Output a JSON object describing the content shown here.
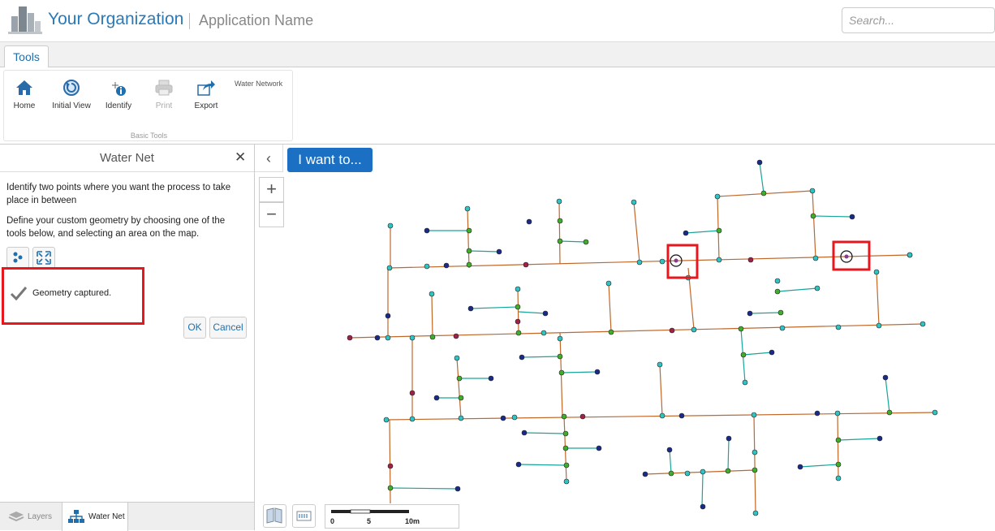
{
  "header": {
    "org_name": "Your Organization",
    "app_name": "Application Name",
    "search_placeholder": "Search..."
  },
  "ribbon": {
    "tabs": [
      "Tools"
    ],
    "tools": [
      {
        "label": "Home",
        "icon": "home-icon",
        "enabled": true
      },
      {
        "label": "Initial View",
        "icon": "initial-view-icon",
        "enabled": true
      },
      {
        "label": "Identify",
        "icon": "identify-icon",
        "enabled": true
      },
      {
        "label": "Print",
        "icon": "printer-icon",
        "enabled": false
      },
      {
        "label": "Export",
        "icon": "export-icon",
        "enabled": true
      }
    ],
    "group_label": "Basic Tools",
    "extra_label": "Water Network"
  },
  "panel": {
    "title": "Water Net",
    "instruction1": "Identify two points where you want the process to take place in between",
    "instruction2": "Define your custom geometry by choosing one of the tools below, and selecting an area on the map.",
    "status": "Geometry captured.",
    "ok_label": "OK",
    "cancel_label": "Cancel",
    "bottom_tabs": [
      {
        "label": "Layers",
        "icon": "layers-icon",
        "active": false
      },
      {
        "label": "Water Net",
        "icon": "network-icon",
        "active": true
      }
    ]
  },
  "map": {
    "iwant_label": "I want to...",
    "zoom_in": "+",
    "zoom_out": "−",
    "scale_labels": [
      "0",
      "5",
      "10m"
    ],
    "colors": {
      "pipe_main": "#c0672a",
      "pipe_service": "#1aa59a",
      "node_cyan": "#2ec4c4",
      "node_green": "#3fae2a",
      "node_navy": "#1a2a8a",
      "node_maroon": "#a0204a",
      "highlight": "#e8171e"
    }
  }
}
